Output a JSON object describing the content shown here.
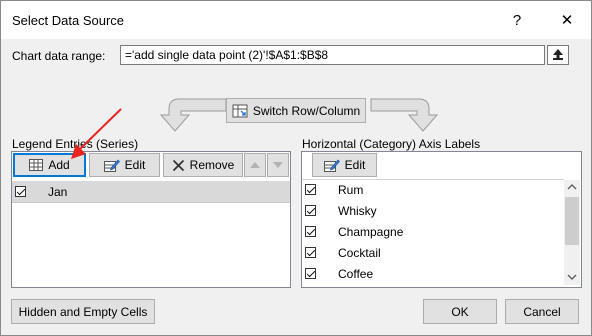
{
  "window": {
    "title": "Select Data Source",
    "help_glyph": "?",
    "close_glyph": "✕"
  },
  "chart_range": {
    "label": "Chart data range:",
    "value": "='add single data point (2)'!$A$1:$B$8"
  },
  "switch_button": {
    "label": "Switch Row/Column"
  },
  "legend": {
    "header": "Legend Entries (Series)",
    "add_label": "Add",
    "edit_label": "Edit",
    "remove_label": "Remove",
    "series": [
      {
        "name": "Jan",
        "checked": true
      }
    ]
  },
  "axis": {
    "header": "Horizontal (Category) Axis Labels",
    "edit_label": "Edit",
    "items": [
      {
        "label": "Rum",
        "checked": true
      },
      {
        "label": "Whisky",
        "checked": true
      },
      {
        "label": "Champagne",
        "checked": true
      },
      {
        "label": "Cocktail",
        "checked": true
      },
      {
        "label": "Coffee",
        "checked": true
      }
    ]
  },
  "footer": {
    "hidden_cells_label": "Hidden and Empty Cells",
    "ok_label": "OK",
    "cancel_label": "Cancel"
  },
  "colors": {
    "focus": "#0078d7",
    "selection": "#cce8ff",
    "annotation_arrow": "#e8251f"
  },
  "icons": [
    "help-icon",
    "close-icon",
    "collapse-dialog-icon",
    "switch-row-column-icon",
    "add-series-icon",
    "edit-series-icon",
    "remove-icon",
    "move-up-icon",
    "move-down-icon",
    "edit-axis-icon",
    "checkbox-checked-icon",
    "scroll-up-icon",
    "scroll-down-icon"
  ]
}
